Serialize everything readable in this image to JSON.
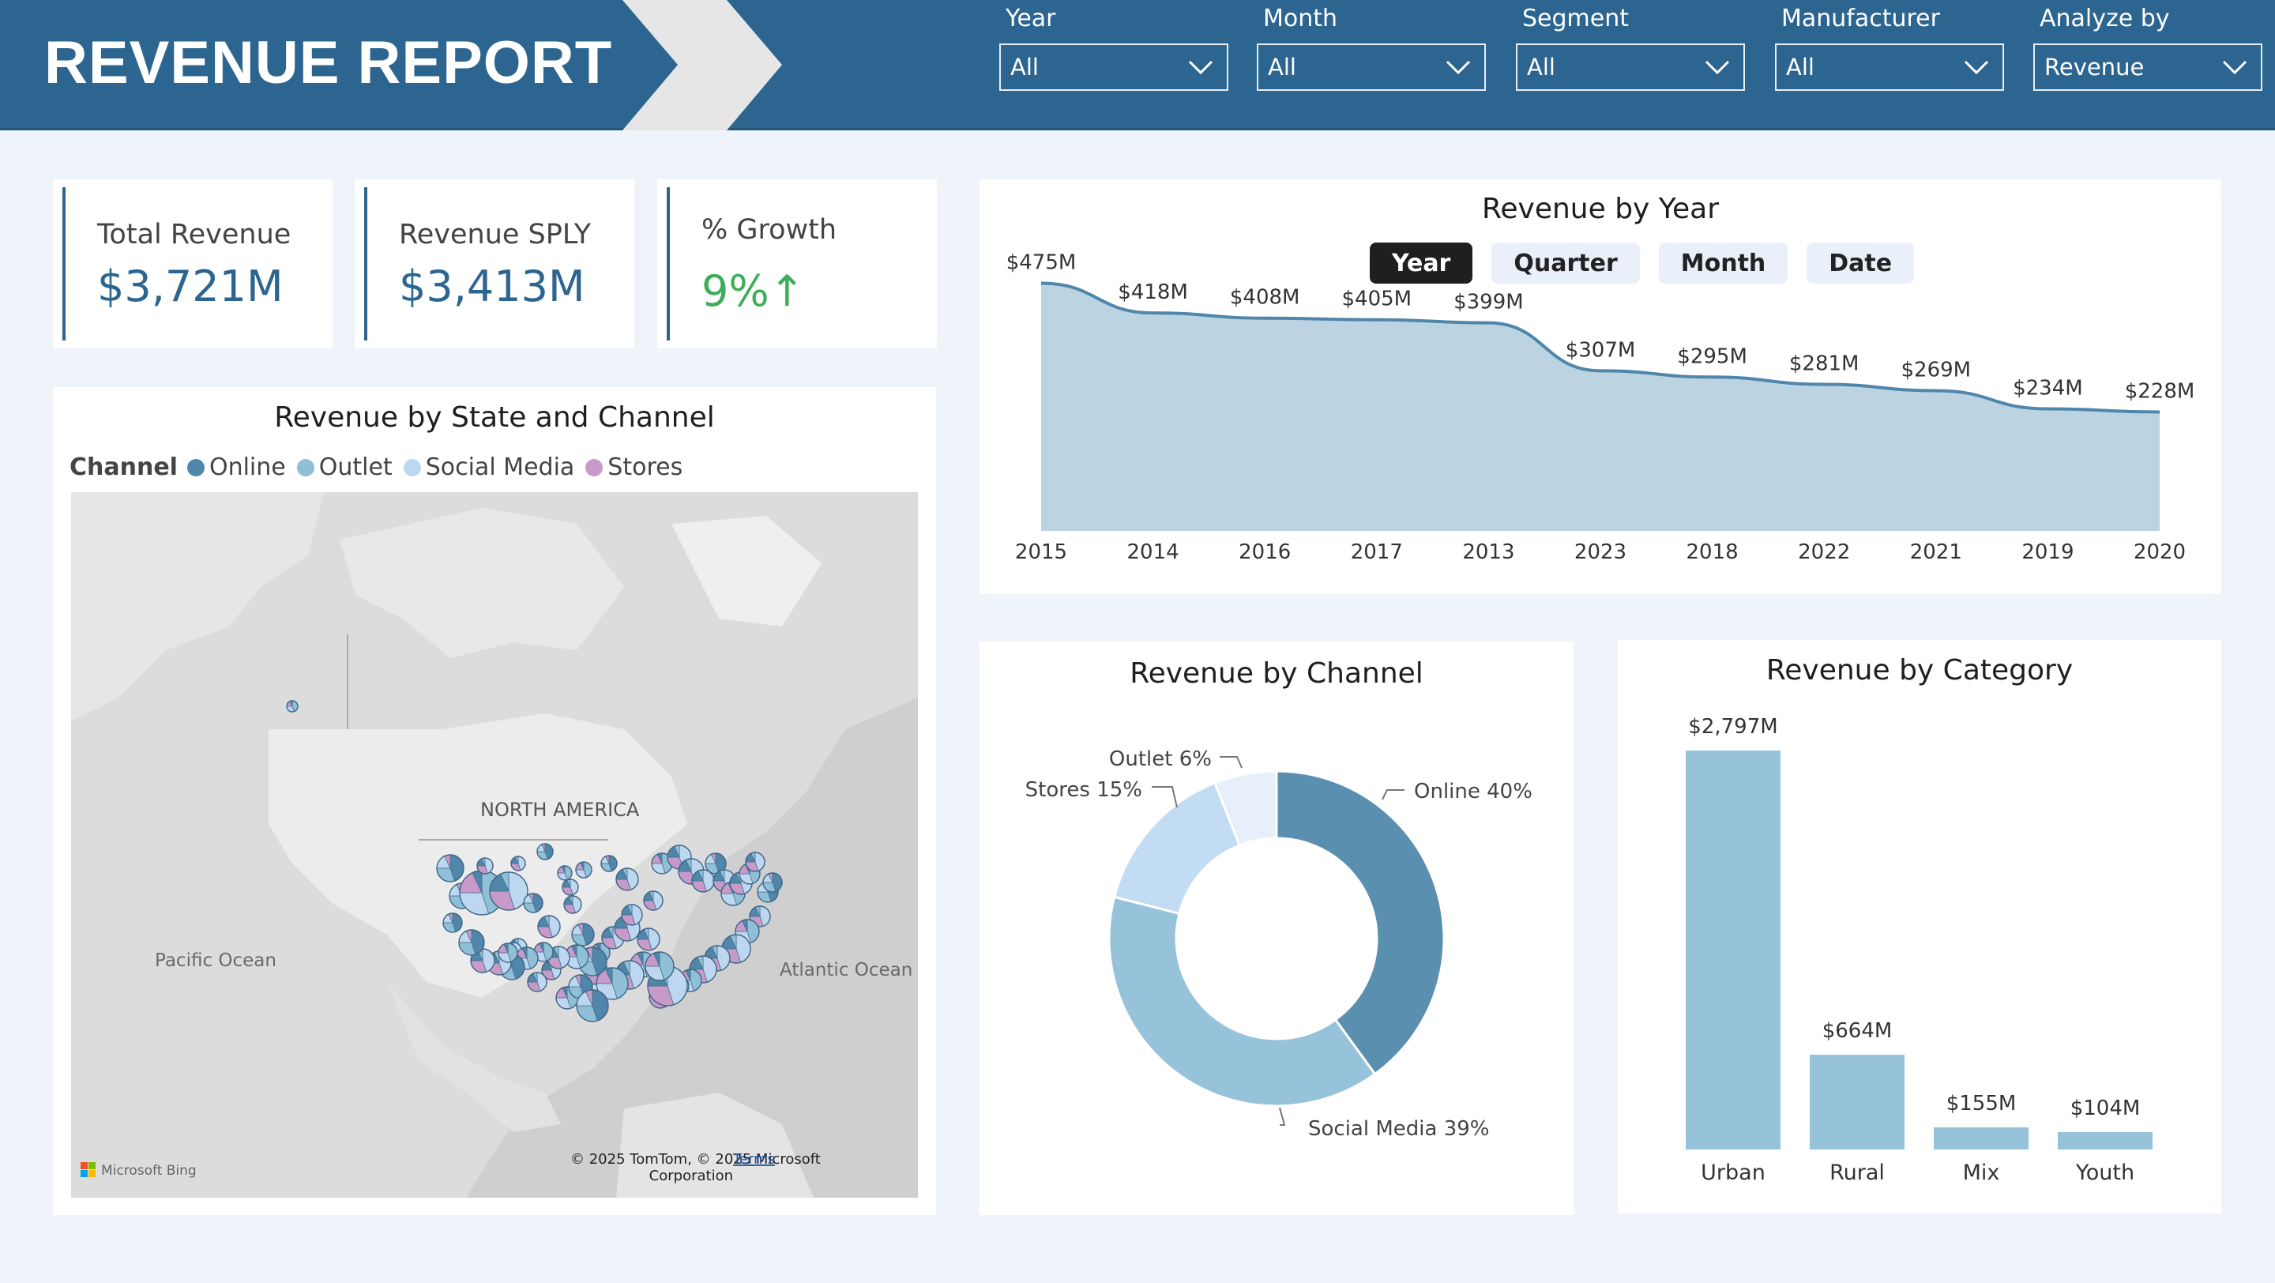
{
  "header": {
    "title": "REVENUE REPORT",
    "filters": [
      {
        "label": "Year",
        "value": "All"
      },
      {
        "label": "Month",
        "value": "All"
      },
      {
        "label": "Segment",
        "value": "All"
      },
      {
        "label": "Manufacturer",
        "value": "All"
      },
      {
        "label": "Analyze by",
        "value": "Revenue"
      }
    ]
  },
  "kpis": [
    {
      "label": "Total Revenue",
      "value": "$3,721M"
    },
    {
      "label": "Revenue SPLY",
      "value": "$3,413M"
    },
    {
      "label": "% Growth",
      "value": "9%↑"
    }
  ],
  "map": {
    "title": "Revenue by State and Channel",
    "legend_title": "Channel",
    "legend": [
      {
        "name": "Online",
        "color": "#4f86aa"
      },
      {
        "name": "Outlet",
        "color": "#8fc0d8"
      },
      {
        "name": "Social Media",
        "color": "#bdd7f0"
      },
      {
        "name": "Stores",
        "color": "#c79ac9"
      }
    ],
    "labels": {
      "continent": "NORTH AMERICA",
      "pacific": "Pacific Ocean",
      "atlantic": "Atlantic Ocean"
    },
    "attribution": "© 2025 TomTom, © 2025 Microsoft",
    "attribution2": "Corporation",
    "terms": "Terms",
    "provider": "Microsoft Bing"
  },
  "year_chart": {
    "toggles": [
      "Year",
      "Quarter",
      "Month",
      "Date"
    ],
    "active_toggle": "Year"
  },
  "category_chart": {
    "title": "Revenue by Category"
  },
  "channel_chart": {
    "title": "Revenue by Channel"
  },
  "chart_data": [
    {
      "type": "area",
      "title": "Revenue by Year",
      "categories": [
        "2015",
        "2014",
        "2016",
        "2017",
        "2013",
        "2023",
        "2018",
        "2022",
        "2021",
        "2019",
        "2020"
      ],
      "values": [
        475,
        418,
        408,
        405,
        399,
        307,
        295,
        281,
        269,
        234,
        228
      ],
      "data_labels": [
        "$475M",
        "$418M",
        "$408M",
        "$405M",
        "$399M",
        "$307M",
        "$295M",
        "$281M",
        "$269M",
        "$234M",
        "$228M"
      ],
      "color": "#4f86aa",
      "fill": "#bcd4e2"
    },
    {
      "type": "pie",
      "title": "Revenue by Channel",
      "categories": [
        "Online",
        "Social Media",
        "Stores",
        "Outlet"
      ],
      "values": [
        40,
        39,
        15,
        6
      ],
      "data_labels": [
        "Online 40%",
        "Social Media 39%",
        "Stores 15%",
        "Outlet 6%"
      ],
      "colors": [
        "#5a8fb0",
        "#97c3da",
        "#c2dcf3",
        "#e7f0fa"
      ]
    },
    {
      "type": "bar",
      "title": "Revenue by Category",
      "categories": [
        "Urban",
        "Rural",
        "Mix",
        "Youth"
      ],
      "values": [
        2797,
        664,
        155,
        104
      ],
      "data_labels": [
        "$2,797M",
        "$664M",
        "$155M",
        "$104M"
      ],
      "color": "#97c3da"
    }
  ]
}
